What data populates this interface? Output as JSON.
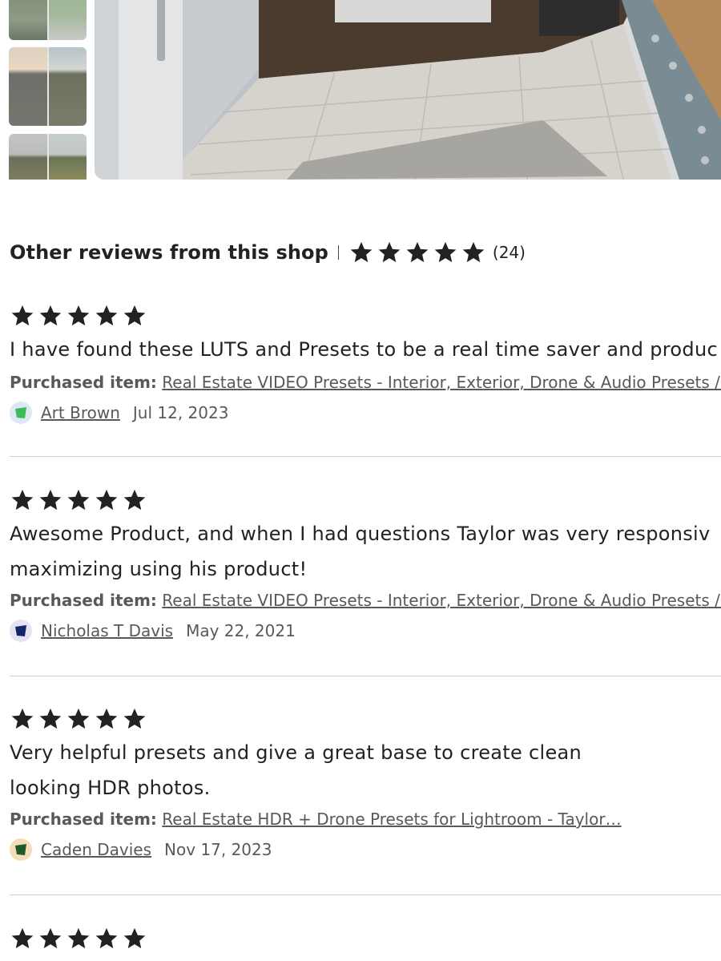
{
  "header": {
    "title": "Other reviews from this shop",
    "separator": "|",
    "rating_stars": 5,
    "count": "(24)"
  },
  "reviews": [
    {
      "stars": 5,
      "text": "I have found these LUTS and Presets to be a real time saver and produc",
      "purchased_label": "Purchased item:",
      "item": "Real Estate VIDEO Presets - Interior, Exterior, Drone & Audio Presets / L",
      "author": "Art Brown",
      "date": "Jul 12, 2023",
      "avatar_color": "#3dba5c"
    },
    {
      "stars": 5,
      "text_line1": "Awesome Product, and when I had questions Taylor was very responsiv",
      "text_line2": "maximizing using his product!",
      "purchased_label": "Purchased item:",
      "item": "Real Estate VIDEO Presets - Interior, Exterior, Drone & Audio Presets / L",
      "author": "Nicholas T Davis",
      "date": "May 22, 2021",
      "avatar_color": "#13256b"
    },
    {
      "stars": 5,
      "text_line1": "Very helpful presets and give a great base to create clean",
      "text_line2": "looking HDR photos.",
      "purchased_label": "Purchased item:",
      "item": "Real Estate HDR + Drone Presets for Lightroom - Taylor…",
      "author": "Caden Davies",
      "date": "Nov 17, 2023",
      "avatar_color": "#1d5a2a"
    },
    {
      "stars": 5
    }
  ],
  "colors": {
    "text": "#222222",
    "muted": "#595959",
    "rule": "#cfcfcf"
  },
  "icons": [
    "star-icon",
    "avatar-icon"
  ]
}
